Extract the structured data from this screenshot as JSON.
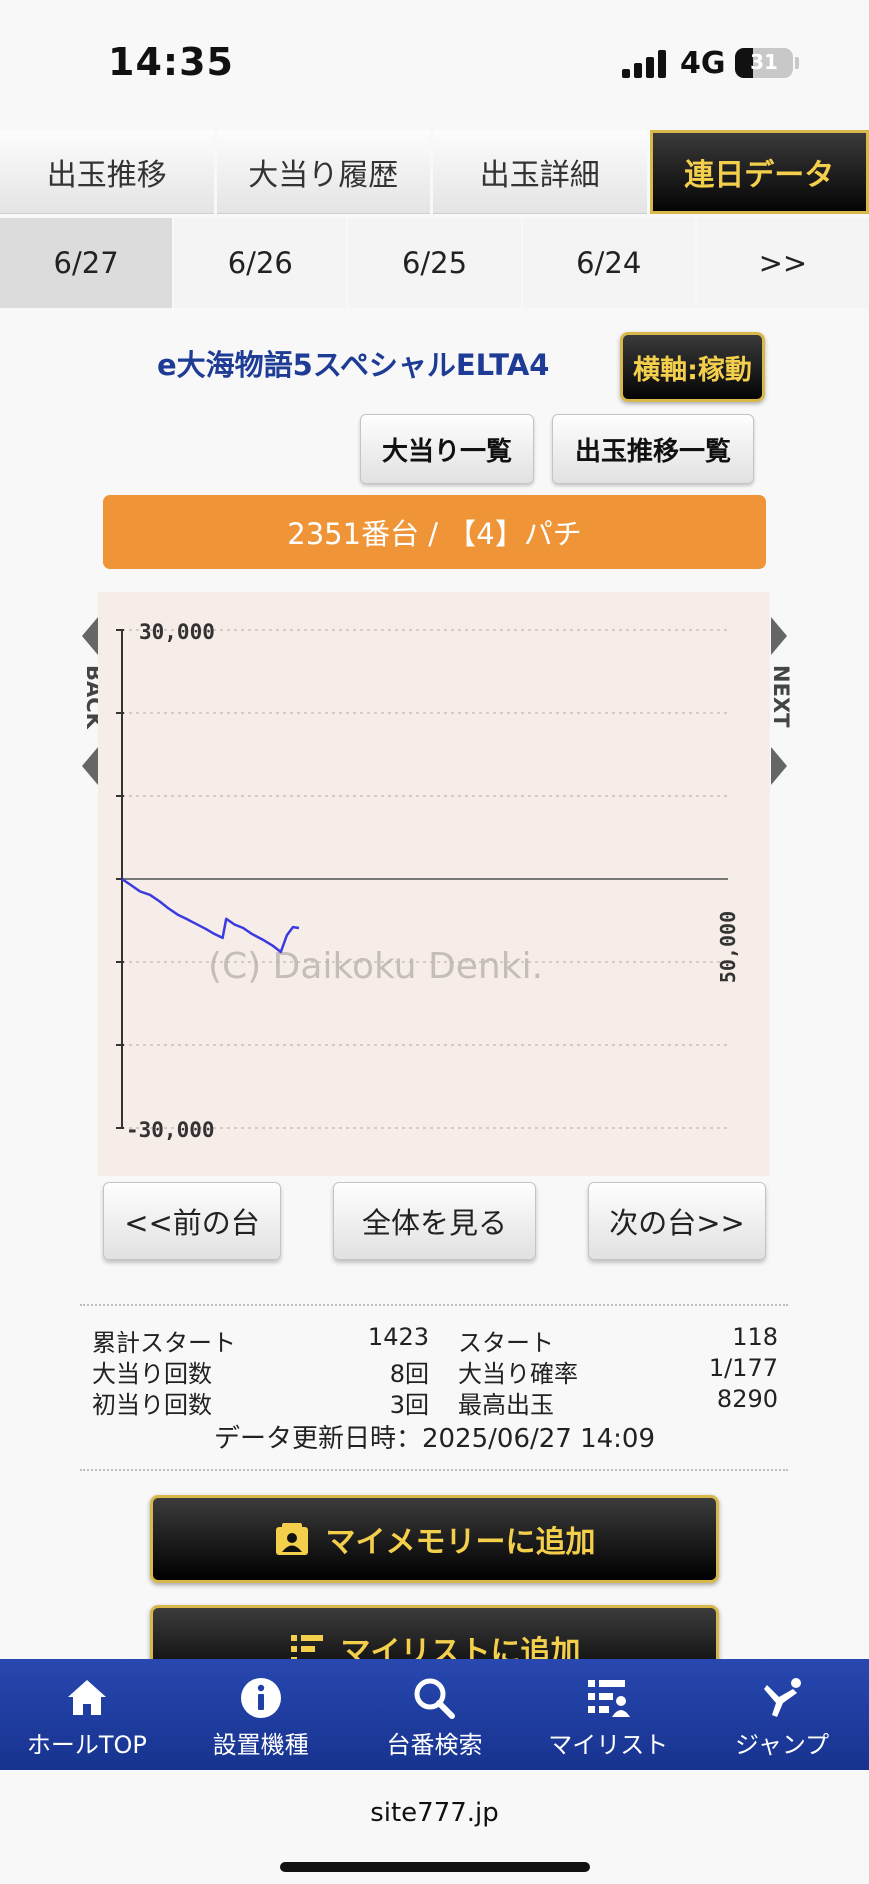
{
  "status": {
    "time": "14:35",
    "network": "4G",
    "battery": "31",
    "battery_level": 0.31
  },
  "main_tabs": [
    "出玉推移",
    "大当り履歴",
    "出玉詳細",
    "連日データ"
  ],
  "date_tabs": [
    "6/27",
    "6/26",
    "6/25",
    "6/24",
    ">>"
  ],
  "machine": {
    "name": "e大海物語5スペシャルELTA4",
    "axis_button": "横軸:稼動",
    "list_button": "大当り一覧",
    "trend_list_button": "出玉推移一覧",
    "unit_label": "2351番台 / 【4】パチ"
  },
  "chart_data": {
    "type": "line",
    "y_tick_labels": [
      "30,000",
      "-30,000"
    ],
    "x_tick_labels": [
      "50,000"
    ],
    "ylim": [
      -30000,
      30000
    ],
    "xlim": [
      0,
      50000
    ],
    "grid": true,
    "watermark": "(C) Daikoku Denki.",
    "series": [
      {
        "color": "#3a3ae0",
        "points": [
          [
            0,
            0
          ],
          [
            800,
            -800
          ],
          [
            1500,
            -1500
          ],
          [
            2300,
            -1900
          ],
          [
            3100,
            -2700
          ],
          [
            3800,
            -3500
          ],
          [
            4600,
            -4300
          ],
          [
            5300,
            -4800
          ],
          [
            6100,
            -5400
          ],
          [
            6900,
            -6000
          ],
          [
            7600,
            -6600
          ],
          [
            8300,
            -7100
          ],
          [
            8600,
            -4800
          ],
          [
            9300,
            -5500
          ],
          [
            10000,
            -5900
          ],
          [
            10700,
            -6600
          ],
          [
            11600,
            -7300
          ],
          [
            12400,
            -8000
          ],
          [
            13100,
            -8800
          ],
          [
            13600,
            -6800
          ],
          [
            14100,
            -5800
          ],
          [
            14600,
            -5900
          ]
        ]
      }
    ],
    "side_labels": {
      "back": "BACK",
      "next": "NEXT"
    }
  },
  "nav_buttons": {
    "prev": "<<前の台",
    "all": "全体を見る",
    "next": "次の台>>"
  },
  "stats": [
    {
      "label": "累計スタート",
      "value": "1423",
      "label2": "スタート",
      "value2": "118"
    },
    {
      "label": "大当り回数",
      "value": "8回",
      "label2": "大当り確率",
      "value2": "1/177"
    },
    {
      "label": "初当り回数",
      "value": "3回",
      "label2": "最高出玉",
      "value2": "8290"
    }
  ],
  "updated": "データ更新日時：2025/06/27 14:09",
  "actions": {
    "memory": "マイメモリーに追加",
    "mylist": "マイリストに追加"
  },
  "bottom_nav": [
    {
      "label": "ホールTOP",
      "icon": "home-icon"
    },
    {
      "label": "設置機種",
      "icon": "info-icon"
    },
    {
      "label": "台番検索",
      "icon": "search-icon"
    },
    {
      "label": "マイリスト",
      "icon": "mylist-icon"
    },
    {
      "label": "ジャンプ",
      "icon": "jump-icon"
    }
  ],
  "browser": {
    "url": "site777.jp"
  },
  "colors": {
    "accent_gold": "#f4cf4c",
    "banner_orange": "#ef9437",
    "nav_blue": "#2245a8",
    "title_blue": "#1e3c96"
  }
}
